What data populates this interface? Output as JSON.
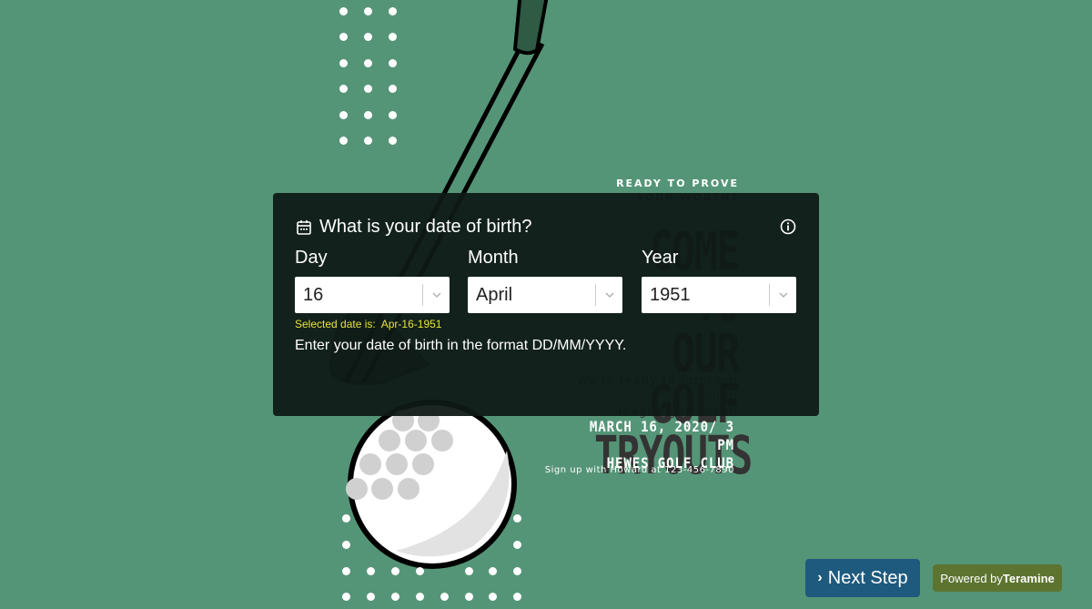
{
  "background": {
    "color": "#559577",
    "poster": {
      "ready_line1": "READY TO PROVE",
      "ready_line2": "YOUR WORTH?",
      "headline": [
        "COME TO",
        "OUR GOLF",
        "TRYOUTS"
      ],
      "subtext": [
        "We're ready to form our junior",
        "league golf team!"
      ],
      "event_date": "MARCH 16, 2020/ 3 PM",
      "event_place": "HEWES GOLF CLUB",
      "signup": "Sign up with Howard at 123-456-7890"
    }
  },
  "dialog": {
    "title_icon": "calendar-icon",
    "title": "What is your date of birth?",
    "info_icon": "info-icon",
    "fields": [
      {
        "label": "Day",
        "value": "16"
      },
      {
        "label": "Month",
        "value": "April"
      },
      {
        "label": "Year",
        "value": "1951"
      }
    ],
    "selected_prefix": "Selected date is:",
    "selected_value": "Apr-16-1951",
    "hint": "Enter your date of birth in the format DD/MM/YYYY."
  },
  "footer": {
    "next_icon": "chevron-right-icon",
    "next_label": "Next Step",
    "next_color": "#1e5a7e",
    "powered_prefix": "Powered by",
    "powered_brand": "Teramine",
    "powered_color": "#5d7430"
  }
}
